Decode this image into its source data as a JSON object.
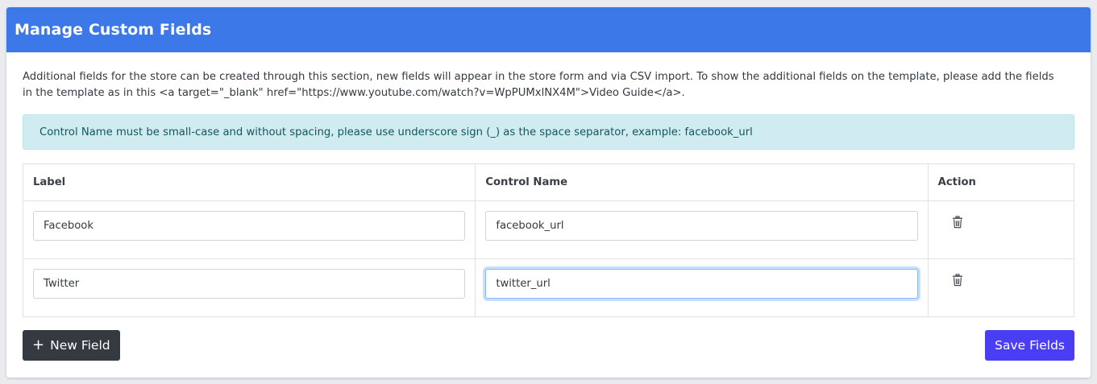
{
  "card": {
    "title": "Manage Custom Fields",
    "description": "Additional fields for the store can be created through this section, new fields will appear in the store form and via CSV import. To show the additional fields on the template, please add the fields in the template as in this <a target=\"_blank\" href=\"https://www.youtube.com/watch?v=WpPUMxlNX4M\">Video Guide</a>.",
    "alert": "Control Name must be small-case and without spacing, please use underscore sign (_) as the space separator, example: facebook_url"
  },
  "table": {
    "headers": {
      "label": "Label",
      "control_name": "Control Name",
      "action": "Action"
    },
    "rows": [
      {
        "label": "Facebook",
        "control_name": "facebook_url",
        "action_icon": "trash-icon"
      },
      {
        "label": "Twitter",
        "control_name": "twitter_url",
        "action_icon": "trash-icon",
        "focused": true
      }
    ]
  },
  "buttons": {
    "new_field": "New Field",
    "new_field_icon": "plus-icon",
    "save_fields": "Save Fields"
  },
  "colors": {
    "header": "#3c78e8",
    "alert_bg": "#d1ecf0",
    "alert_text": "#14555f",
    "new_field_btn": "#343a40",
    "save_btn": "#4a3ef5"
  }
}
